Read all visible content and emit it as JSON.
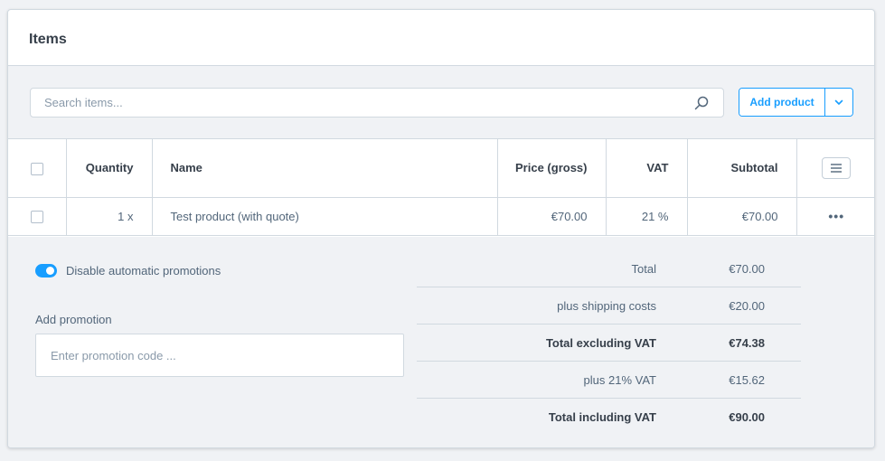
{
  "card": {
    "title": "Items"
  },
  "toolbar": {
    "search_placeholder": "Search items...",
    "add_product_label": "Add product"
  },
  "table": {
    "headers": {
      "quantity": "Quantity",
      "name": "Name",
      "price": "Price (gross)",
      "vat": "VAT",
      "subtotal": "Subtotal"
    },
    "rows": [
      {
        "quantity": "1 x",
        "name": "Test product (with quote)",
        "price": "€70.00",
        "vat": "21 %",
        "subtotal": "€70.00"
      }
    ]
  },
  "promotions": {
    "toggle_label": "Disable automatic promotions",
    "toggle_on": true,
    "add_label": "Add promotion",
    "code_placeholder": "Enter promotion code ..."
  },
  "totals": [
    {
      "label": "Total",
      "value": "€70.00"
    },
    {
      "label": "plus shipping costs",
      "value": "€20.00"
    },
    {
      "label": "Total excluding VAT",
      "value": "€74.38"
    },
    {
      "label": "plus 21% VAT",
      "value": "€15.62"
    },
    {
      "label": "Total including VAT",
      "value": "€90.00"
    }
  ],
  "colors": {
    "accent": "#189eff",
    "background": "#f0f2f5",
    "border": "#d1d9e0"
  },
  "icons": {
    "search": "search-icon",
    "dropdown": "chevron-down-icon",
    "settings": "column-settings-icon",
    "actions": "more-horizontal-icon"
  }
}
